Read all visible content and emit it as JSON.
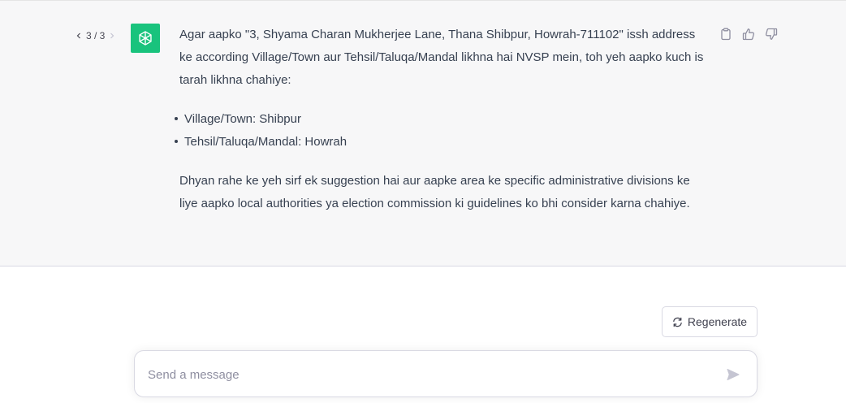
{
  "pager": {
    "label": "3 / 3",
    "prev_icon": "chevron-left-icon",
    "next_icon": "chevron-right-icon"
  },
  "assistant": {
    "avatar_icon": "openai-logo-icon",
    "avatar_color": "#19c37d"
  },
  "message": {
    "intro": "Agar aapko \"3, Shyama Charan Mukherjee Lane, Thana Shibpur, Howrah-711102\" issh address ke according Village/Town aur Tehsil/Taluqa/Mandal likhna hai NVSP mein, toh yeh aapko kuch is tarah likhna chahiye:",
    "bullets": [
      "Village/Town: Shibpur",
      "Tehsil/Taluqa/Mandal: Howrah"
    ],
    "outro": "Dhyan rahe ke yeh sirf ek suggestion hai aur aapke area ke specific administrative divisions ke liye aapko local authorities ya election commission ki guidelines ko bhi consider karna chahiye."
  },
  "actions": {
    "copy_icon": "clipboard-icon",
    "like_icon": "thumbs-up-icon",
    "dislike_icon": "thumbs-down-icon"
  },
  "regenerate": {
    "label": "Regenerate",
    "icon": "refresh-icon"
  },
  "composer": {
    "placeholder": "Send a message",
    "value": "",
    "send_icon": "send-icon"
  }
}
